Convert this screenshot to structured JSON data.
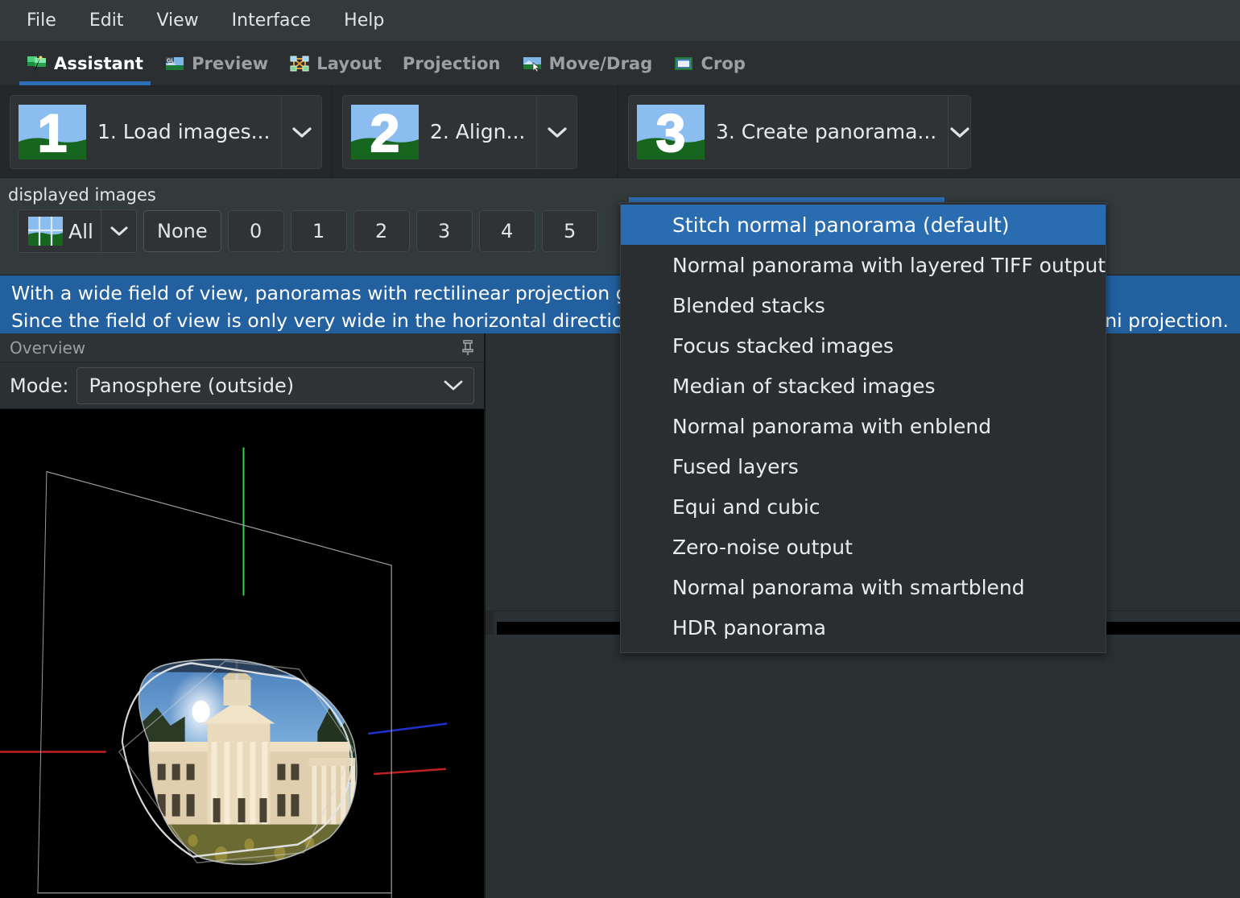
{
  "menubar": {
    "items": [
      {
        "label": "File"
      },
      {
        "label": "Edit"
      },
      {
        "label": "View"
      },
      {
        "label": "Interface"
      },
      {
        "label": "Help"
      }
    ]
  },
  "tabs": [
    {
      "label": "Assistant",
      "icon": "assistant-icon",
      "active": true
    },
    {
      "label": "Preview",
      "icon": "preview-gl-icon",
      "active": false
    },
    {
      "label": "Layout",
      "icon": "layout-icon",
      "active": false
    },
    {
      "label": "Projection",
      "icon": "",
      "active": false
    },
    {
      "label": "Move/Drag",
      "icon": "move-drag-icon",
      "active": false
    },
    {
      "label": "Crop",
      "icon": "crop-icon",
      "active": false
    }
  ],
  "assistant": {
    "steps": [
      {
        "number": "1",
        "label": "1. Load images...",
        "icon": "step-1-icon",
        "active": false
      },
      {
        "number": "2",
        "label": "2. Align...",
        "icon": "step-2-icon",
        "active": false
      },
      {
        "number": "3",
        "label": "3. Create panorama...",
        "icon": "step-3-icon",
        "active": true
      }
    ]
  },
  "displayed_images": {
    "title": "displayed images",
    "all_label": "All",
    "none_label": "None",
    "numbers": [
      "0",
      "1",
      "2",
      "3",
      "4",
      "5"
    ]
  },
  "banner": {
    "line1": "With a wide field of view, panoramas with rectilinear projection get v",
    "line2_start": "Since the field of view is only very wide in the horizontal direction, try",
    "line2_end": "ini projection."
  },
  "overview": {
    "title": "Overview",
    "pin_icon": "pushpin-icon",
    "mode_label": "Mode:",
    "mode_value": "Panosphere (outside)"
  },
  "dropdown": {
    "items": [
      {
        "label": "Stitch normal panorama (default)",
        "selected": true
      },
      {
        "label": "Normal panorama with layered TIFF output",
        "selected": false
      },
      {
        "label": "Blended stacks",
        "selected": false
      },
      {
        "label": "Focus stacked images",
        "selected": false
      },
      {
        "label": "Median of stacked images",
        "selected": false
      },
      {
        "label": "Normal panorama with enblend",
        "selected": false
      },
      {
        "label": "Fused layers",
        "selected": false
      },
      {
        "label": "Equi and cubic",
        "selected": false
      },
      {
        "label": "Zero-noise output",
        "selected": false
      },
      {
        "label": "Normal panorama with smartblend",
        "selected": false
      },
      {
        "label": "HDR panorama",
        "selected": false
      }
    ]
  },
  "colors": {
    "accent_blue": "#23609f",
    "selection_blue": "#2a6cb0",
    "window_bg": "#25282b",
    "menubar_bg": "#323a3c",
    "panel_bg": "#2b3033",
    "text": "#e2e4e6"
  }
}
